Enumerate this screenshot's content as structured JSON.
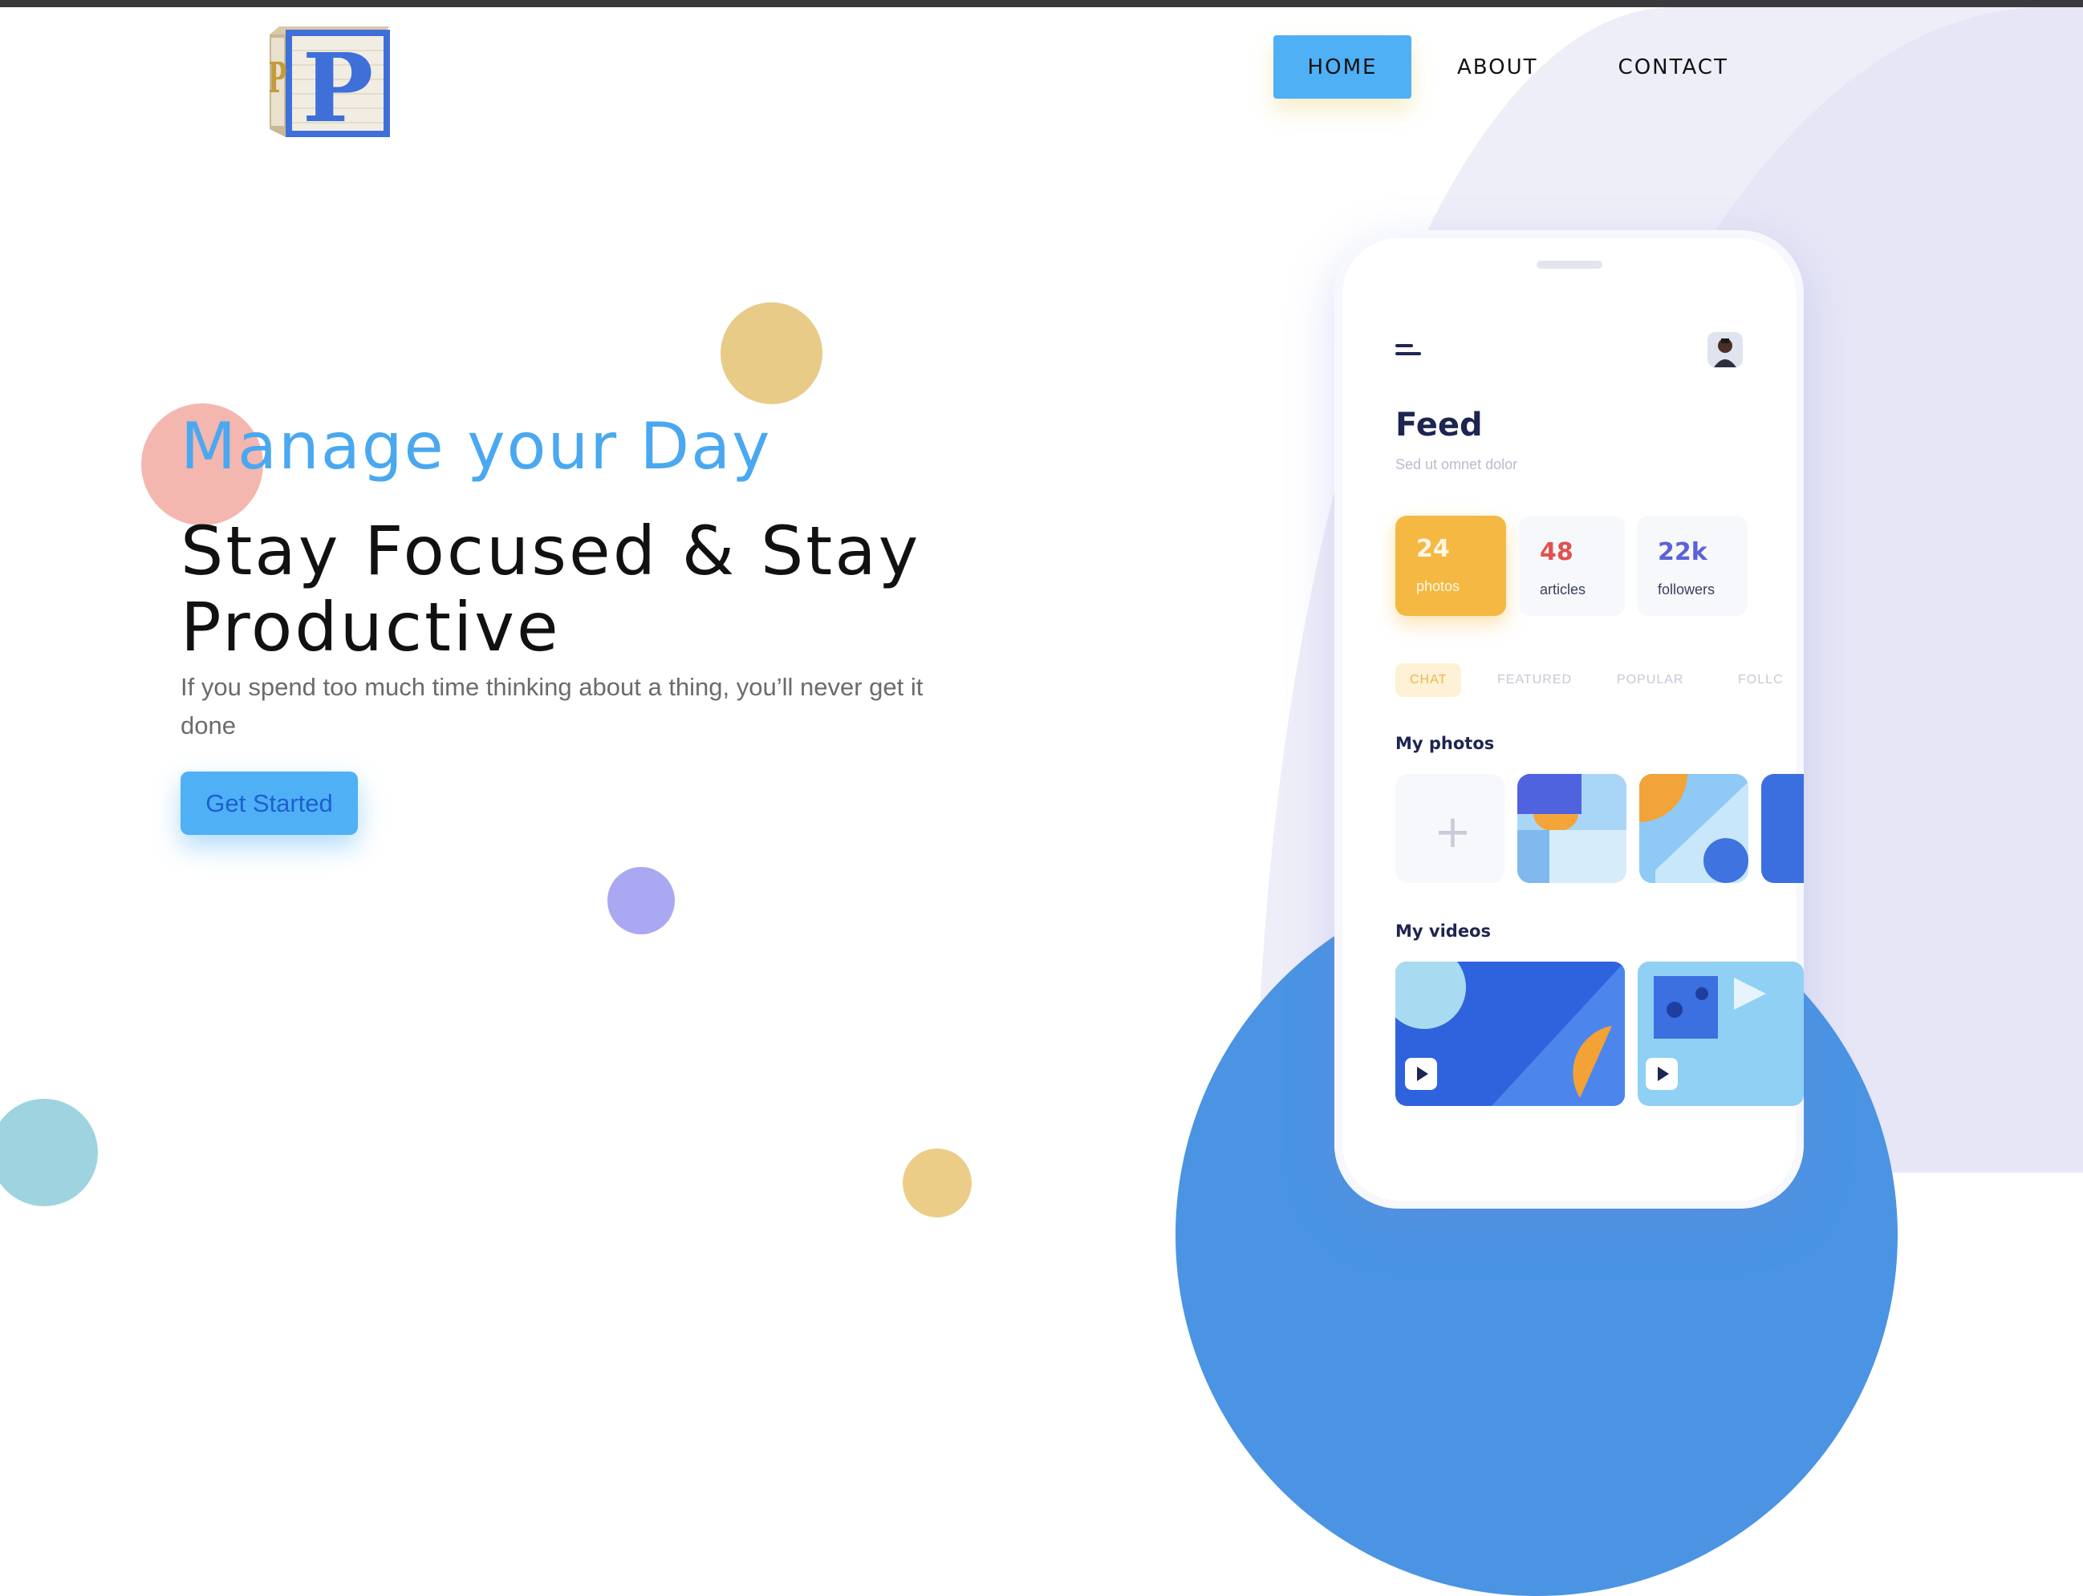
{
  "nav": {
    "home": "HOME",
    "about": "ABOUT",
    "contact": "CONTACT"
  },
  "logo": {
    "letter": "P",
    "side_letter": "P"
  },
  "hero": {
    "subtitle": "Manage your Day",
    "title_line1": "Stay Focused & Stay",
    "title_line2": "Productive",
    "text": "If you spend too much time thinking about a thing, you’ll never get it done",
    "cta_label": "Get Started"
  },
  "phone": {
    "feed_title": "Feed",
    "feed_subtitle": "Sed ut omnet dolor",
    "stats": [
      {
        "value": "24",
        "label": "photos"
      },
      {
        "value": "48",
        "label": "articles"
      },
      {
        "value": "22k",
        "label": "followers"
      }
    ],
    "tabs": [
      "CHAT",
      "FEATURED",
      "POPULAR",
      "FOLLC"
    ],
    "my_photos": "My photos",
    "add_symbol": "+",
    "my_videos": "My videos"
  },
  "colors": {
    "accent_blue": "#4fb0f5",
    "hero_subtitle": "#4aa8f0",
    "orange": "#f5b843",
    "coral_dot": "#f0a39c",
    "yellow_dot": "#e6c77e",
    "purple_dot": "#a9a6f3",
    "teal_dot": "#98d3df",
    "blob_blue": "#4a94e3"
  }
}
